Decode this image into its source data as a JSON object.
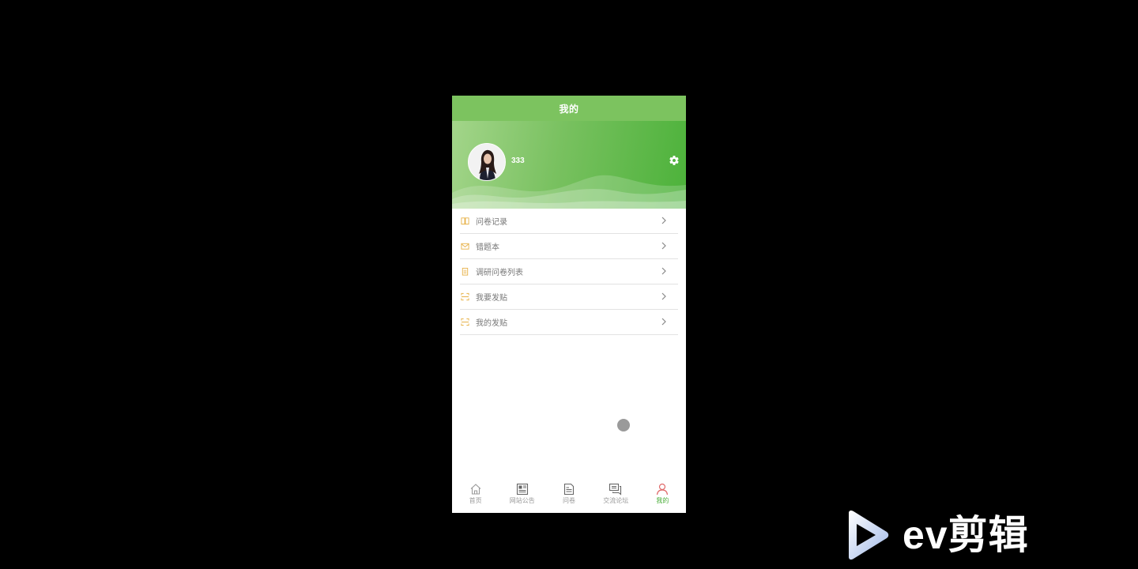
{
  "header": {
    "title": "我的"
  },
  "profile": {
    "username": "333",
    "avatar_icon": "avatar",
    "settings_icon": "gear-icon"
  },
  "menu": {
    "items": [
      {
        "label": "问卷记录",
        "icon": "book-icon"
      },
      {
        "label": "错题本",
        "icon": "mail-icon"
      },
      {
        "label": "调研问卷列表",
        "icon": "clipboard-icon"
      },
      {
        "label": "我要发贴",
        "icon": "scan-icon"
      },
      {
        "label": "我的发贴",
        "icon": "scan-icon"
      }
    ]
  },
  "tabbar": {
    "items": [
      {
        "label": "首页",
        "icon": "home-icon",
        "active": false
      },
      {
        "label": "网站公告",
        "icon": "news-icon",
        "active": false
      },
      {
        "label": "问卷",
        "icon": "document-icon",
        "active": false
      },
      {
        "label": "交流论坛",
        "icon": "chat-icon",
        "active": false
      },
      {
        "label": "我的",
        "icon": "user-icon",
        "active": true
      }
    ]
  },
  "watermark": {
    "text": "ev剪辑"
  },
  "colors": {
    "header_green": "#7cc35f",
    "active_tab": "#4aae39",
    "menu_icon": "#e7b24a",
    "active_user_icon": "#e06b6b"
  }
}
